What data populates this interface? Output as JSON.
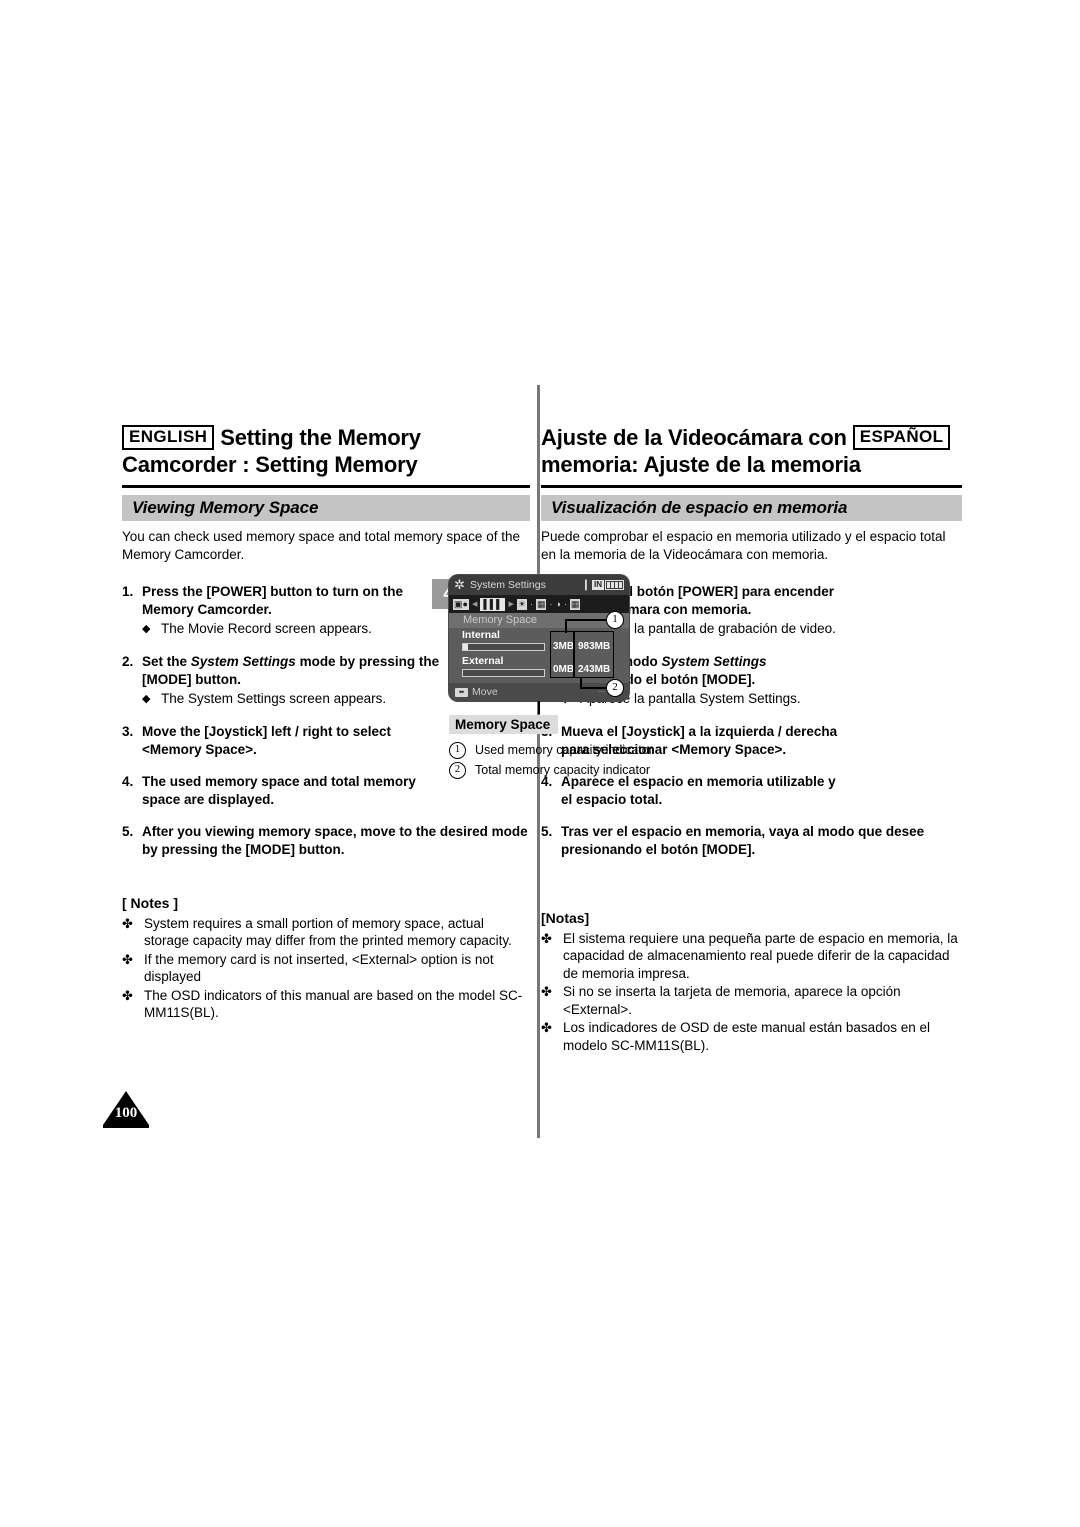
{
  "header": {
    "english": {
      "lang_tag": "ENGLISH",
      "title_line1": "Setting the Memory",
      "title_line2": "Camcorder : Setting Memory"
    },
    "spanish": {
      "lang_tag": "ESPAÑOL",
      "title_line1": "Ajuste de la Videocámara con",
      "title_line2": "memoria: Ajuste de la memoria"
    }
  },
  "section": {
    "english_bar": "Viewing Memory Space",
    "spanish_bar": "Visualización de espacio en memoria"
  },
  "english": {
    "intro_line1": "You can check used memory space and total memory space of the",
    "intro_line2": "Memory Camcorder.",
    "steps": [
      {
        "num": "1.",
        "line1": "Press the [POWER] button to turn on the",
        "line2": "Memory Camcorder.",
        "bullet": "◆",
        "sub": "The Movie Record screen appears."
      },
      {
        "num": "2.",
        "pre": "Set the ",
        "italic": "System Settings",
        "post": " mode by pressing the",
        "line2": "[MODE] button.",
        "bullet": "◆",
        "sub": "The System Settings screen appears."
      },
      {
        "num": "3.",
        "line1": "Move the [Joystick] left / right to select",
        "line2": "<Memory Space>."
      },
      {
        "num": "4.",
        "line1": "The used memory space and total memory",
        "line2": "space are displayed."
      },
      {
        "num": "5.",
        "line1": "After you viewing memory space, move to the desired mode",
        "line2": "by pressing the [MODE] button."
      }
    ],
    "notes_title": "[ Notes ]",
    "notes_bullet": "✤",
    "notes": [
      "System requires a small portion of memory space, actual storage capacity may differ from the printed memory capacity.",
      "If the memory card is not inserted, <External> option is not displayed",
      "The OSD indicators of this manual are based on the model SC-MM11S(BL)."
    ]
  },
  "spanish": {
    "intro_line1": "Puede comprobar el espacio en memoria utilizado y el espacio total",
    "intro_line2": "en la memoria de la Videocámara con memoria.",
    "steps": [
      {
        "num": "1.",
        "line1": "Presione el botón [POWER] para encender",
        "line2": "la Videocámara con memoria.",
        "bullet": "◆",
        "sub": "Aparece la pantalla de grabación de video."
      },
      {
        "num": "2.",
        "pre": "Ajuste el modo ",
        "italic": "System Settings",
        "post": "",
        "line2": "presionando el botón [MODE].",
        "bullet": "◆",
        "sub": "Aparece la pantalla System Settings."
      },
      {
        "num": "3.",
        "line1": "Mueva el [Joystick] a la izquierda / derecha",
        "line2": "para seleccionar <Memory Space>."
      },
      {
        "num": "4.",
        "line1": "Aparece el espacio en memoria utilizable y",
        "line2": "el espacio total."
      },
      {
        "num": "5.",
        "line1": "Tras ver el espacio en memoria, vaya al modo que desee",
        "line2": "presionando el botón [MODE]."
      }
    ],
    "notes_title": "[Notas]",
    "notes_bullet": "✤",
    "notes": [
      "El sistema requiere una pequeña parte de espacio en memoria, la capacidad de almacenamiento real puede diferir de la capacidad de memoria impresa.",
      "Si no se inserta la tarjeta de memoria, aparece la opción <External>.",
      "Los indicadores de OSD de este manual están basados en el modelo SC-MM11S(BL)."
    ]
  },
  "figure": {
    "step_marker": "4",
    "lcd": {
      "title": "System Settings",
      "battery_in_label": "IN",
      "submenu_label": "Memory Space",
      "rows": [
        {
          "label": "Internal",
          "used": "3MB",
          "total": "983MB",
          "fill_percent": 6
        },
        {
          "label": "External",
          "used": "0MB",
          "total": "243MB",
          "fill_percent": 0
        }
      ],
      "bottom_hint": "Move"
    },
    "callout_1": "1",
    "callout_2": "2",
    "caption": "Memory Space",
    "legend": [
      {
        "num": "1",
        "text": "Used memory capacity indicator"
      },
      {
        "num": "2",
        "text": "Total memory capacity indicator"
      }
    ]
  },
  "page_number": "100",
  "colors": {
    "section_bar": "#c4c4c4",
    "divider": "#76797b",
    "lcd_body": "#5c5c5c",
    "lcd_titlebar": "#3c3c3c",
    "lcd_tabbar": "#1c1c1c"
  }
}
